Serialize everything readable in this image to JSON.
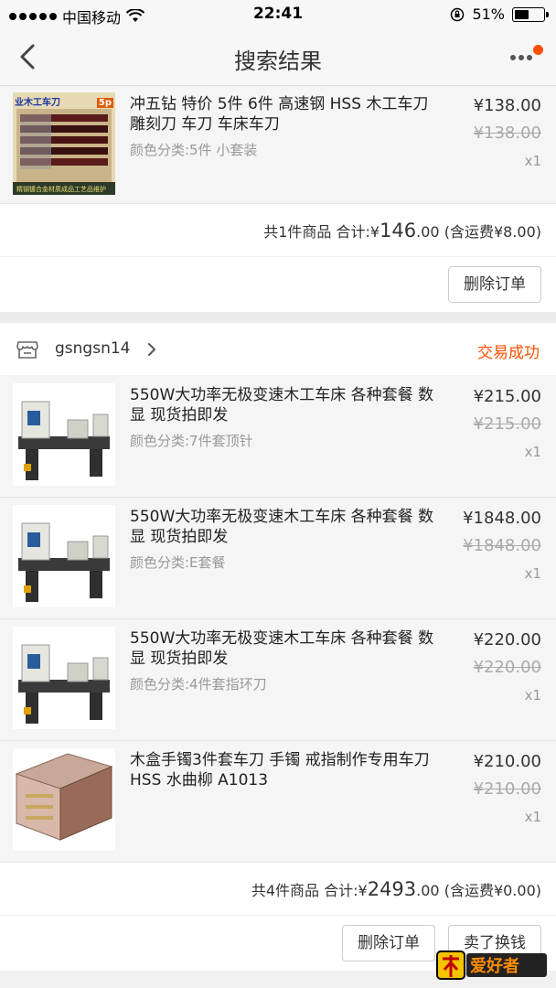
{
  "status_bar": {
    "carrier": "中国移动",
    "time": "22:41",
    "battery": "51%",
    "battery_level": 0.51
  },
  "nav": {
    "title": "搜索结果",
    "back_icon": "chevron-left-icon",
    "more_icon": "more-dots-icon",
    "badge_color": "#ff5000"
  },
  "order1": {
    "items": [
      {
        "title": "冲五钻 特价 5件 6件 高速钢 HSS 木工车刀 雕刻刀 车刀 车床车刀",
        "spec": "颜色分类:5件 小套装",
        "price": "¥138.00",
        "old_price": "¥138.00",
        "qty": "x1",
        "thumb_text": "业木工车刀",
        "thumb_badge": "5p",
        "thumb_footer": "精钢镀合金材质成品工艺品维护"
      }
    ],
    "summary": {
      "prefix": "共1件商品 合计:¥",
      "total_int": "146",
      "total_dec": ".00",
      "shipping": "(含运费¥8.00)"
    },
    "delete_label": "删除订单"
  },
  "order2": {
    "shop_name": "gsngsn14",
    "status": "交易成功",
    "status_color": "#ff5000",
    "items": [
      {
        "title": "550W大功率无极变速木工车床 各种套餐 数显 现货拍即发",
        "spec": "颜色分类:7件套顶针",
        "price": "¥215.00",
        "old_price": "¥215.00",
        "qty": "x1"
      },
      {
        "title": "550W大功率无极变速木工车床 各种套餐 数显 现货拍即发",
        "spec": "颜色分类:E套餐",
        "price": "¥1848.00",
        "old_price": "¥1848.00",
        "qty": "x1"
      },
      {
        "title": "550W大功率无极变速木工车床 各种套餐 数显 现货拍即发",
        "spec": "颜色分类:4件套指环刀",
        "price": "¥220.00",
        "old_price": "¥220.00",
        "qty": "x1"
      },
      {
        "title": "木盒手镯3件套车刀 手镯 戒指制作专用车刀 HSS 水曲柳 A1013",
        "spec": "",
        "price": "¥210.00",
        "old_price": "¥210.00",
        "qty": "x1"
      }
    ],
    "summary": {
      "prefix": "共4件商品 合计:¥",
      "total_int": "2493",
      "total_dec": ".00",
      "shipping": "(含运费¥0.00)"
    },
    "delete_label": "删除订单",
    "resell_label": "卖了换钱"
  },
  "watermark": {
    "text": "木工爱好者"
  }
}
